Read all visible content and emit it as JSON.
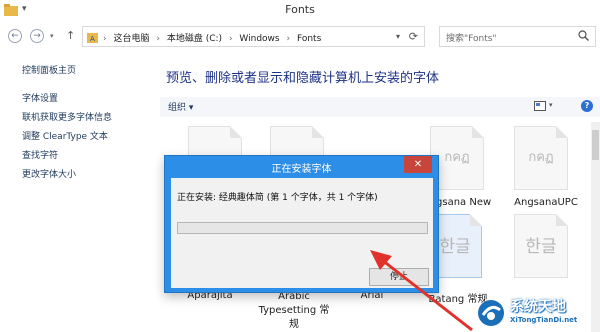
{
  "window": {
    "title": "Fonts",
    "quick_access": "▾"
  },
  "address": {
    "crumbs": [
      "这台电脑",
      "本地磁盘 (C:)",
      "Windows",
      "Fonts"
    ],
    "search_placeholder": "搜索\"Fonts\""
  },
  "left_pane": {
    "items": [
      "控制面板主页",
      "字体设置",
      "联机获取更多字体信息",
      "调整 ClearType 文本",
      "查找字符",
      "更改字体大小"
    ]
  },
  "main": {
    "heading": "预览、删除或者显示和隐藏计算机上安装的字体",
    "organize_label": "组织 ▾",
    "help": "?"
  },
  "tiles": [
    {
      "glyph": "",
      "label": ""
    },
    {
      "glyph": "",
      "label": ""
    },
    {
      "glyph": "กคฏ",
      "label": "Angsana New"
    },
    {
      "glyph": "กคฏ",
      "label": "AngsanaUPC"
    },
    {
      "glyph": "",
      "label": "Aparajita"
    },
    {
      "glyph": "",
      "label": "Arabic Typesetting 常规"
    },
    {
      "glyph": "",
      "label": "Arial"
    },
    {
      "glyph": "한글",
      "label": "Batang 常规"
    },
    {
      "glyph": "한글",
      "label": ""
    }
  ],
  "dialog": {
    "title": "正在安装字体",
    "close": "✕",
    "status": "正在安装: 经典趣体简 (第 1 个字体，共 1 个字体)",
    "progress_fraction": 0.0,
    "stop_button": "停止"
  },
  "watermark": {
    "cn": "系统天地",
    "en": "XiTongTianDi.net"
  },
  "colors": {
    "dialog_title_bg": "#2d8ee7",
    "close_red": "#c7453a",
    "arrow_red": "#e0312a"
  }
}
